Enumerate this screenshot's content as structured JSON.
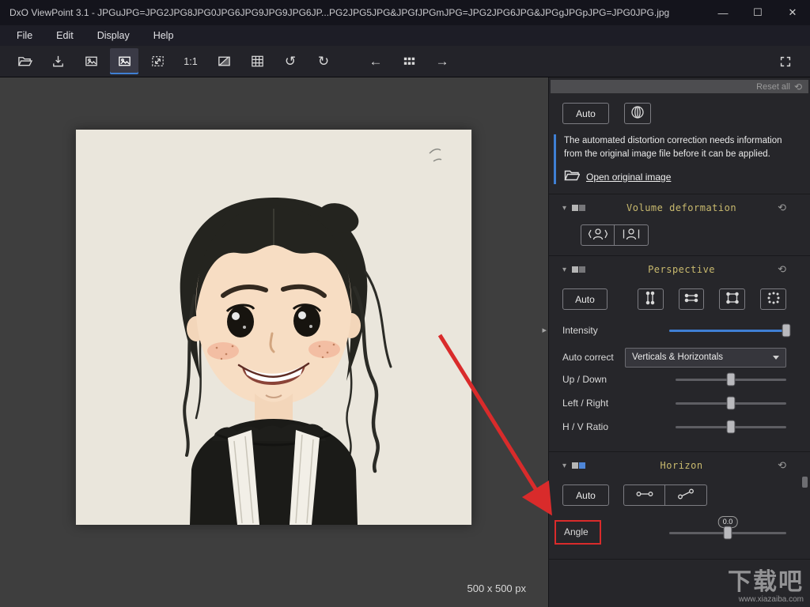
{
  "window": {
    "title": "DxO ViewPoint 3.1 - JPGuJPG=JPG2JPG8JPG0JPG6JPG9JPG9JPG6JP...PG2JPG5JPG&JPGfJPGmJPG=JPG2JPG6JPG&JPGgJPGpJPG=JPG0JPG.jpg",
    "controls": {
      "minimize": "—",
      "maximize": "☐",
      "close": "✕"
    }
  },
  "menu": {
    "items": [
      "File",
      "Edit",
      "Display",
      "Help"
    ]
  },
  "toolbar": {
    "zoom_label": "1:1"
  },
  "canvas": {
    "size_label": "500 x 500 px"
  },
  "panel": {
    "reset_all_label": "Reset all",
    "top": {
      "auto_label": "Auto"
    },
    "info_text": "The automated distortion correction needs information from the original image file before it can be applied.",
    "open_original_label": "Open original image",
    "volume": {
      "title": "Volume deformation"
    },
    "perspective": {
      "title": "Perspective",
      "auto_label": "Auto",
      "intensity_label": "Intensity",
      "auto_correct_label": "Auto correct",
      "auto_correct_value": "Verticals & Horizontals",
      "up_down_label": "Up / Down",
      "left_right_label": "Left / Right",
      "hv_ratio_label": "H / V Ratio"
    },
    "horizon": {
      "title": "Horizon",
      "auto_label": "Auto",
      "angle_label": "Angle",
      "angle_value": "0.0"
    }
  },
  "watermark": {
    "line1": "下载吧",
    "line2": "www.xiazaiba.com"
  },
  "colors": {
    "accent_blue": "#3f7fd4",
    "section_title": "#c9ba6e",
    "annotation_red": "#d92b2b",
    "canvas_bg": "#3e3e3e",
    "panel_bg": "#26262a"
  }
}
